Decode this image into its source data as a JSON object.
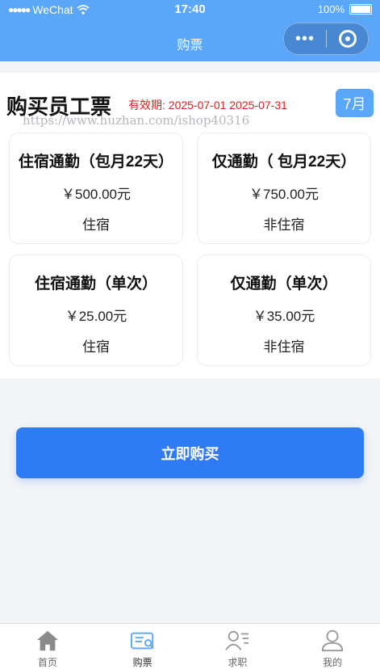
{
  "status_bar": {
    "carrier": "WeChat",
    "time": "17:40",
    "battery": "100%"
  },
  "nav": {
    "title": "购票"
  },
  "header": {
    "title": "购买员工票",
    "validity_label": "有效期:",
    "validity_range": "2025-07-01 2025-07-31",
    "month_button": "7月",
    "watermark": "https://www.huzhan.com/ishop40316"
  },
  "tickets": [
    {
      "name": "住宿通勤（包月22天）",
      "price": "￥500.00元",
      "type": "住宿"
    },
    {
      "name": "仅通勤（ 包月22天）",
      "price": "￥750.00元",
      "type": "非住宿"
    },
    {
      "name": "住宿通勤（单次）",
      "price": "￥25.00元",
      "type": "住宿"
    },
    {
      "name": "仅通勤（单次）",
      "price": "￥35.00元",
      "type": "非住宿"
    }
  ],
  "buy_button": "立即购买",
  "tabs": [
    {
      "label": "首页",
      "icon": "home-icon"
    },
    {
      "label": "购票",
      "icon": "ticket-icon"
    },
    {
      "label": "求职",
      "icon": "resume-icon"
    },
    {
      "label": "我的",
      "icon": "user-icon"
    }
  ],
  "colors": {
    "primary": "#5aa6f8",
    "button": "#2f7bf6",
    "validity": "#e02020",
    "background": "#f3f4f6"
  }
}
